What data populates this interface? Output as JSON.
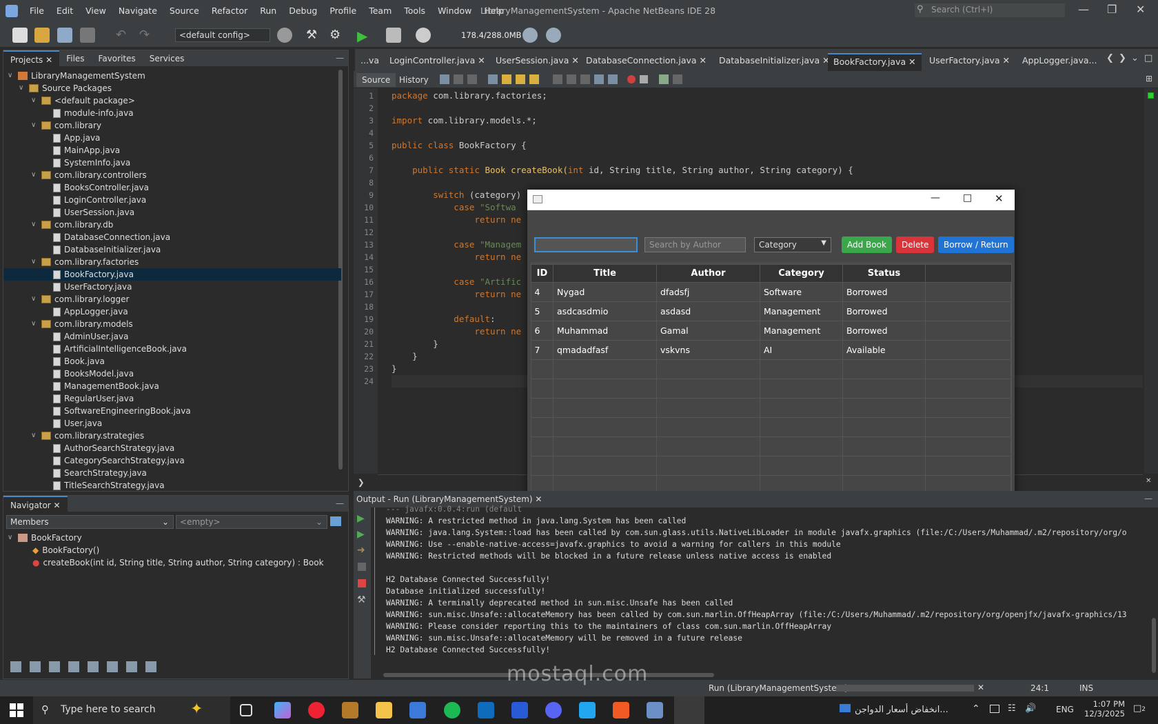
{
  "window": {
    "title": "LibraryManagementSystem - Apache NetBeans IDE 28"
  },
  "menu": [
    "File",
    "Edit",
    "View",
    "Navigate",
    "Source",
    "Refactor",
    "Run",
    "Debug",
    "Profile",
    "Team",
    "Tools",
    "Window",
    "Help"
  ],
  "search": {
    "placeholder": "Search (Ctrl+I)"
  },
  "toolbar": {
    "config": "<default config>",
    "memory": "178.4/288.0MB"
  },
  "projects": {
    "tabs": [
      "Projects",
      "Files",
      "Favorites",
      "Services"
    ],
    "nodes": [
      "LibraryManagementSystem",
      "Source Packages",
      "<default package>",
      "module-info.java",
      "com.library",
      "App.java",
      "MainApp.java",
      "SystemInfo.java",
      "com.library.controllers",
      "BooksController.java",
      "LoginController.java",
      "UserSession.java",
      "com.library.db",
      "DatabaseConnection.java",
      "DatabaseInitializer.java",
      "com.library.factories",
      "BookFactory.java",
      "UserFactory.java",
      "com.library.logger",
      "AppLogger.java",
      "com.library.models",
      "AdminUser.java",
      "ArtificialIntelligenceBook.java",
      "Book.java",
      "BooksModel.java",
      "ManagementBook.java",
      "RegularUser.java",
      "SoftwareEngineeringBook.java",
      "User.java",
      "com.library.strategies",
      "AuthorSearchStrategy.java",
      "CategorySearchStrategy.java",
      "SearchStrategy.java",
      "TitleSearchStrategy.java"
    ]
  },
  "navigator": {
    "tab": "Navigator",
    "members": "Members",
    "filter": "<empty>",
    "class": "BookFactory",
    "constructor": "BookFactory()",
    "method": "createBook(int id, String title, String author, String category) : Book"
  },
  "editor": {
    "tabs": [
      "...va",
      "LoginController.java",
      "UserSession.java",
      "DatabaseConnection.java",
      "DatabaseInitializer.java",
      "BookFactory.java",
      "UserFactory.java",
      "AppLogger.java..."
    ],
    "source_tab": "Source",
    "history_tab": "History",
    "lines": [
      "1",
      "2",
      "3",
      "4",
      "5",
      "6",
      "7",
      "8",
      "9",
      "10",
      "11",
      "12",
      "13",
      "14",
      "15",
      "16",
      "17",
      "18",
      "19",
      "20",
      "21",
      "22",
      "23",
      "24"
    ]
  },
  "code": {
    "l1a": "package",
    "l1b": " com.library.factories;",
    "l3a": "import",
    "l3b": " com.library.models.*;",
    "l5a": "public class",
    "l5b": " BookFactory {",
    "l7a": "    public static",
    "l7b": " Book createBook(",
    "l7c": "int",
    "l7d": " id, String title, String author, String category) {",
    "l9a": "        switch",
    "l9b": " (category)",
    "l10a": "            case",
    "l10b": " \"Softwa",
    "l11a": "                return",
    "l11b": " ne",
    "l13a": "            case",
    "l13b": " \"Managem",
    "l14a": "                return",
    "l14b": " ne",
    "l16a": "            case",
    "l16b": " \"Artific",
    "l17a": "                return",
    "l17b": " ne",
    "l19a": "            default",
    "l19b": ":",
    "l20a": "                return",
    "l20b": " ne",
    "l21": "        }",
    "l22": "    }",
    "l23": "}"
  },
  "dialog": {
    "search_author_placeholder": "Search by Author",
    "category": "Category",
    "add": "Add Book",
    "delete": "Delete",
    "borrow": "Borrow / Return",
    "columns": [
      "ID",
      "Title",
      "Author",
      "Category",
      "Status"
    ],
    "rows": [
      [
        "4",
        "Nygad",
        "dfadsfj",
        "Software",
        "Borrowed"
      ],
      [
        "5",
        "asdcasdmio",
        "asdasd",
        "Management",
        "Borrowed"
      ],
      [
        "6",
        "Muhammad",
        "Gamal",
        "Management",
        "Borrowed"
      ],
      [
        "7",
        "qmadadfasf",
        "vskvns",
        "AI",
        "Available"
      ]
    ]
  },
  "output": {
    "title": "Output - Run (LibraryManagementSystem)",
    "lines": [
      "--- javafx:0.0.4:run (default",
      "WARNING: A restricted method in java.lang.System has been called",
      "WARNING: java.lang.System::load has been called by com.sun.glass.utils.NativeLibLoader in module javafx.graphics (file:/C:/Users/Muhammad/.m2/repository/org/o",
      "WARNING: Use --enable-native-access=javafx.graphics to avoid a warning for callers in this module",
      "WARNING: Restricted methods will be blocked in a future release unless native access is enabled",
      "",
      "H2 Database Connected Successfully!",
      "Database initialized successfully!",
      "WARNING: A terminally deprecated method in sun.misc.Unsafe has been called",
      "WARNING: sun.misc.Unsafe::allocateMemory has been called by com.sun.marlin.OffHeapArray (file:/C:/Users/Muhammad/.m2/repository/org/openjfx/javafx-graphics/13",
      "WARNING: Please consider reporting this to the maintainers of class com.sun.marlin.OffHeapArray",
      "WARNING: sun.misc.Unsafe::allocateMemory will be removed in a future release",
      "H2 Database Connected Successfully!"
    ]
  },
  "status": {
    "run": "Run (LibraryManagementSystem)",
    "position": "24:1",
    "mode": "INS"
  },
  "taskbar": {
    "search": "Type here to search",
    "news": "انخفاض أسعار الدواجن...",
    "lang": "ENG",
    "time": "1:07 PM",
    "date": "12/3/2025",
    "notif": "2"
  },
  "watermark": "mostaql.com"
}
